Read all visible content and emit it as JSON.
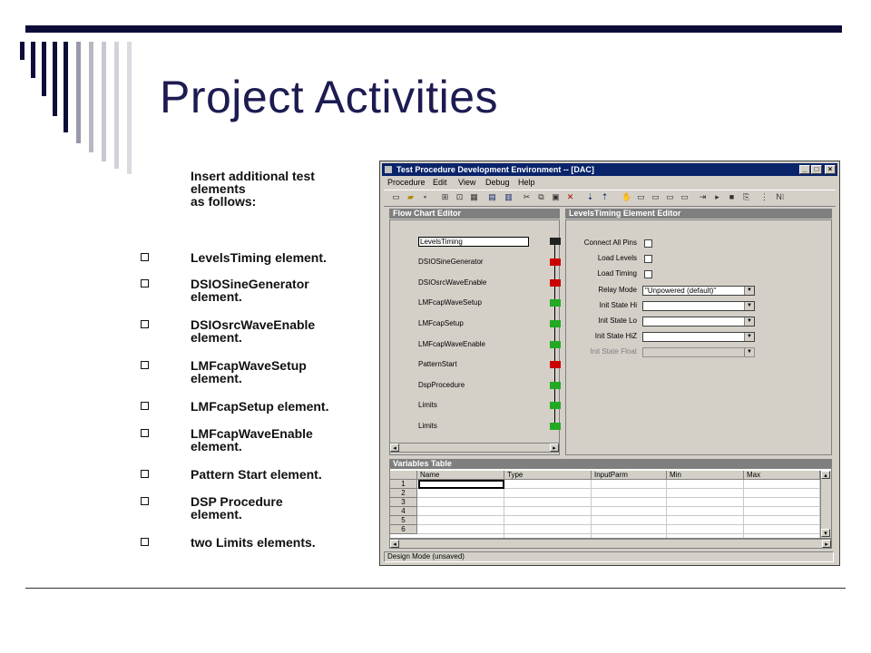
{
  "slide": {
    "title": "Project Activities",
    "intro": [
      "Insert additional test",
      "elements",
      "as follows:"
    ],
    "bullets": [
      [
        "LevelsTiming element."
      ],
      [
        "DSIOSineGenerator",
        "element."
      ],
      [
        "DSIOsrcWaveEnable",
        "element."
      ],
      [
        "LMFcapWaveSetup",
        "element."
      ],
      [
        "LMFcapSetup element."
      ],
      [
        "LMFcapWaveEnable",
        "element."
      ],
      [
        "Pattern Start element."
      ],
      [
        "DSP Procedure",
        "element."
      ],
      [
        "two Limits elements."
      ]
    ]
  },
  "app": {
    "title": "Test Procedure Development Environment -- [DAC]",
    "menu": [
      "Procedure",
      "Edit",
      "View",
      "Debug",
      "Help"
    ],
    "flow_panel_title": "Flow Chart Editor",
    "flow_items": [
      "LevelsTiming",
      "DSIOSineGenerator",
      "DSIOsrcWaveEnable",
      "LMFcapWaveSetup",
      "LMFcapSetup",
      "LMFcapWaveEnable",
      "PatternStart",
      "DspProcedure",
      "Limits",
      "Limits"
    ],
    "editor_title": "LevelsTiming Element Editor",
    "checks": [
      "Connect All Pins",
      "Load Levels",
      "Load Timing"
    ],
    "combos": [
      {
        "label": "Relay Mode",
        "value": "\"Unpowered (default)\""
      },
      {
        "label": "Init State Hi",
        "value": ""
      },
      {
        "label": "Init State Lo",
        "value": ""
      },
      {
        "label": "Init State HiZ",
        "value": ""
      },
      {
        "label": "Init State Float",
        "value": ""
      }
    ],
    "variables_title": "Variables Table",
    "var_columns": [
      "Name",
      "Type",
      "InputParm",
      "Min",
      "Max"
    ],
    "var_rows": [
      "1",
      "2",
      "3",
      "4",
      "5",
      "6"
    ],
    "status": "Design Mode (unsaved)",
    "colors": {
      "titlebar": "#0a246a",
      "slide_title": "#1c1c52",
      "window_face": "#d4d0c8"
    }
  }
}
